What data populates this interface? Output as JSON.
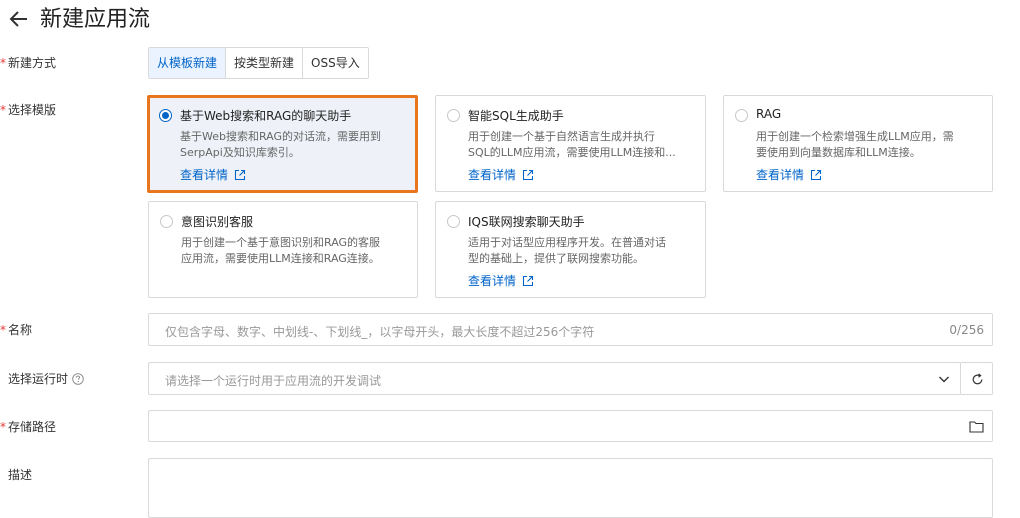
{
  "header": {
    "title": "新建应用流",
    "back_icon": "arrow-left-icon"
  },
  "form": {
    "method": {
      "label": "新建方式",
      "options": [
        "从模板新建",
        "按类型新建",
        "OSS导入"
      ],
      "selected": "从模板新建"
    },
    "template": {
      "label": "选择模版",
      "cards": [
        {
          "title": "基于Web搜索和RAG的聊天助手",
          "desc": "基于Web搜索和RAG的对话流，需要用到\nSerpApi及知识库索引。",
          "link": "查看详情"
        },
        {
          "title": "智能SQL生成助手",
          "desc": "用于创建一个基于自然语言生成并执行\nSQL的LLM应用流，需要使用LLM连接和...",
          "link": "查看详情"
        },
        {
          "title": "RAG",
          "desc": "用于创建一个检索增强生成LLM应用，需\n要使用到向量数据库和LLM连接。",
          "link": "查看详情"
        },
        {
          "title": "意图识别客服",
          "desc": "用于创建一个基于意图识别和RAG的客服\n应用流，需要使用LLM连接和RAG连接。"
        },
        {
          "title": "IQS联网搜索聊天助手",
          "desc": "适用于对话型应用程序开发。在普通对话\n型的基础上，提供了联网搜索功能。",
          "link": "查看详情"
        }
      ]
    },
    "name": {
      "label": "名称",
      "placeholder": "仅包含字母、数字、中划线-、下划线_，以字母开头，最大长度不超过256个字符",
      "counter": "0/256"
    },
    "runtime": {
      "label": "选择运行时",
      "placeholder": "请选择一个运行时用于应用流的开发调试"
    },
    "storage": {
      "label": "存储路径"
    },
    "description": {
      "label": "描述"
    }
  },
  "colors": {
    "accent": "#0064c8",
    "selected_border": "#e8761d",
    "required": "#e23c39"
  }
}
